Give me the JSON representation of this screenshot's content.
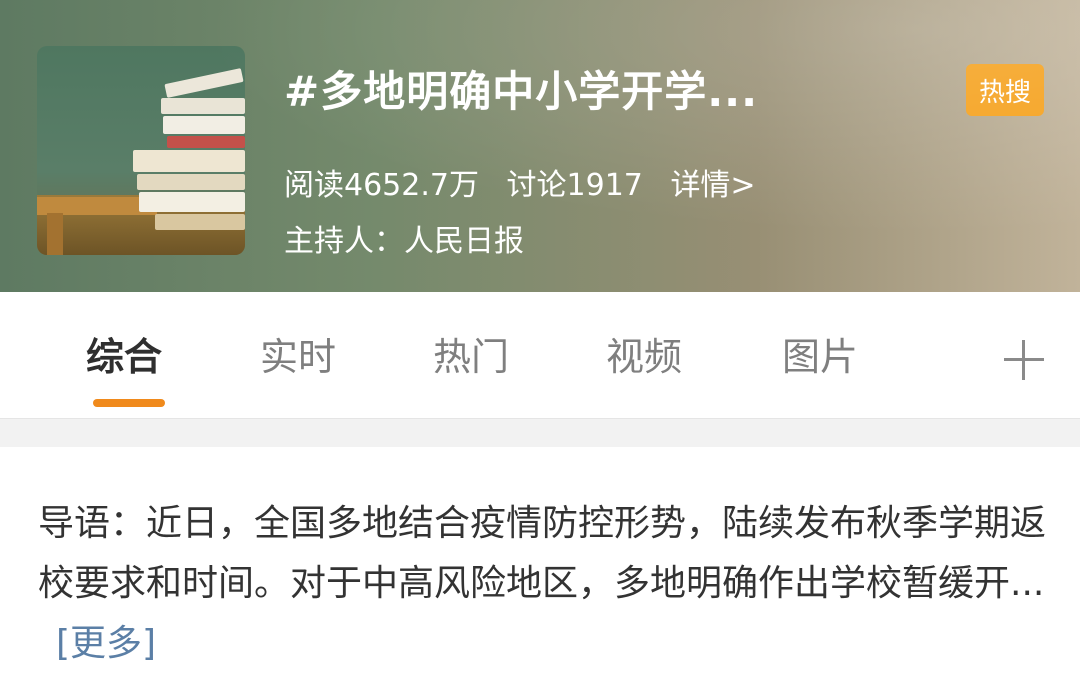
{
  "header": {
    "title": "#多地明确中小学开学...",
    "hot_badge": "热搜",
    "reads": "阅读4652.7万",
    "discussions": "讨论1917",
    "details_link": "详情>",
    "host": "主持人：人民日报"
  },
  "tabs": [
    {
      "label": "综合",
      "active": true
    },
    {
      "label": "实时",
      "active": false
    },
    {
      "label": "热门",
      "active": false
    },
    {
      "label": "视频",
      "active": false
    },
    {
      "label": "图片",
      "active": false
    }
  ],
  "intro": {
    "text": "导语：近日，全国多地结合疫情防控形势，陆续发布秋季学期返校要求和时间。对于中高风险地区，多地明确作出学校暂缓开...",
    "more_label": "[更多]"
  },
  "colors": {
    "accent_orange": "#f08a1c",
    "hot_badge_bg": "#f5a01a",
    "link_blue": "#5b7fa6"
  }
}
